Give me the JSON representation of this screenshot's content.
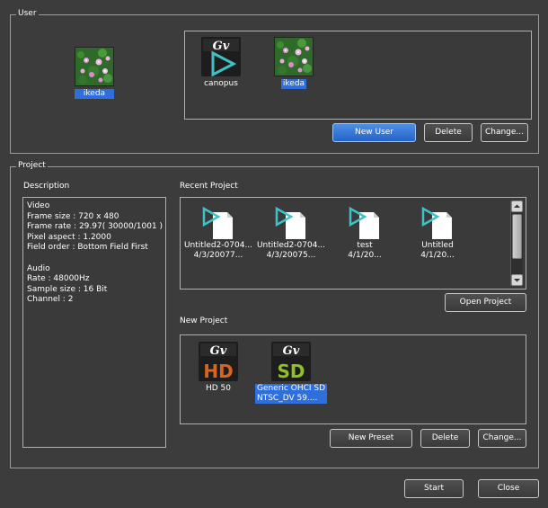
{
  "user_group": {
    "legend": "User",
    "current_user": {
      "name": "ikeda",
      "icon": "flower-avatar-icon"
    },
    "users": [
      {
        "name": "canopus",
        "icon": "gv-logo-icon",
        "selected": false
      },
      {
        "name": "ikeda",
        "icon": "flower-avatar-icon",
        "selected": true
      }
    ],
    "buttons": {
      "new_user": "New User",
      "delete": "Delete",
      "change": "Change..."
    }
  },
  "project_group": {
    "legend": "Project",
    "description": {
      "title": "Description",
      "lines": [
        "Video",
        "Frame size : 720 x 480",
        "Frame rate : 29.97( 30000/1001 )",
        "Pixel aspect : 1.2000",
        "Field order : Bottom Field First",
        "",
        "Audio",
        "Rate : 48000Hz",
        "Sample size : 16 Bit",
        "Channel : 2"
      ]
    },
    "recent": {
      "title": "Recent Project",
      "items": [
        {
          "name": "Untitled2-0704...",
          "date": "4/3/20077...",
          "icon": "project-file-icon"
        },
        {
          "name": "Untitled2-0704...",
          "date": "4/3/20075...",
          "icon": "project-file-icon"
        },
        {
          "name": "test",
          "date": "4/1/20...",
          "icon": "project-file-icon"
        },
        {
          "name": "Untitled",
          "date": "4/1/20...",
          "icon": "project-file-icon"
        }
      ],
      "open_button": "Open Project"
    },
    "new_project": {
      "title": "New Project",
      "presets": [
        {
          "logo": "GV",
          "format": "HD",
          "line1": "HD 50",
          "line2": "",
          "color": "#d8641e",
          "selected": false
        },
        {
          "logo": "GV",
          "format": "SD",
          "line1": "Generic OHCI SD",
          "line2": "NTSC_DV 59....",
          "color": "#8fbf2a",
          "selected": true
        }
      ],
      "buttons": {
        "new_preset": "New Preset",
        "delete": "Delete",
        "change": "Change..."
      }
    }
  },
  "footer": {
    "start": "Start",
    "close": "Close"
  },
  "colors": {
    "selection": "#2e6fdb",
    "primary_button": "#2f74de",
    "background": "#3c3c3c"
  }
}
